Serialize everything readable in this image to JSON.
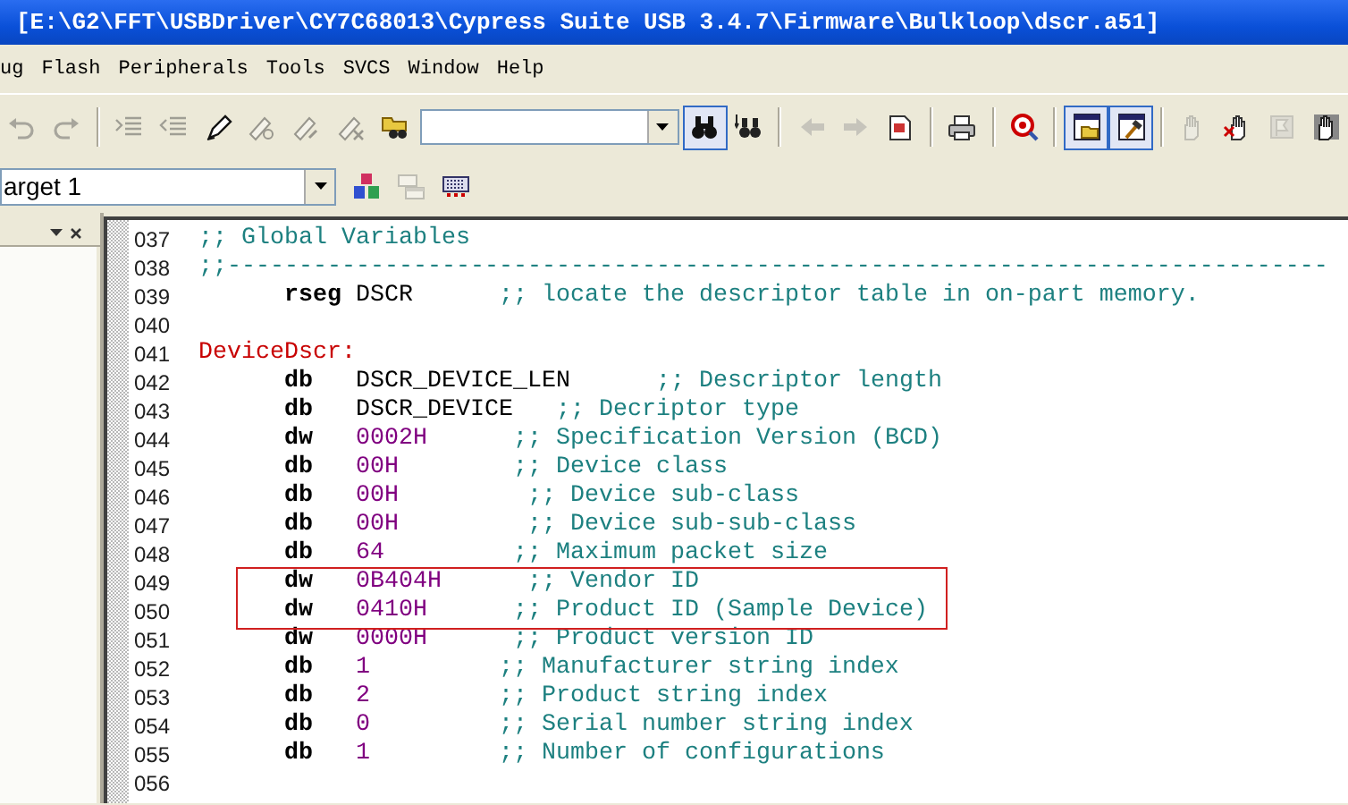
{
  "window": {
    "title": "[E:\\G2\\FFT\\USBDriver\\CY7C68013\\Cypress Suite USB 3.4.7\\Firmware\\Bulkloop\\dscr.a51]"
  },
  "menu_bar": {
    "items": [
      "ug",
      "Flash",
      "Peripherals",
      "Tools",
      "SVCS",
      "Window",
      "Help"
    ]
  },
  "toolbar": {
    "groups": [
      [
        {
          "kind": "undo",
          "disabled": true,
          "pressed": false
        },
        {
          "kind": "redo",
          "disabled": true,
          "pressed": false
        }
      ],
      [
        {
          "kind": "indent",
          "disabled": true,
          "pressed": false
        },
        {
          "kind": "outdent",
          "disabled": true,
          "pressed": false
        },
        {
          "kind": "pen",
          "disabled": false,
          "pressed": false
        },
        {
          "kind": "pen-next",
          "disabled": true,
          "pressed": false
        },
        {
          "kind": "pen-prev",
          "disabled": true,
          "pressed": false
        },
        {
          "kind": "pen-clear",
          "disabled": true,
          "pressed": false
        },
        {
          "kind": "folder-search",
          "disabled": false,
          "pressed": false
        },
        {
          "kind": "combo",
          "disabled": false,
          "pressed": false
        },
        {
          "kind": "find",
          "disabled": false,
          "pressed": true
        },
        {
          "kind": "find-files",
          "disabled": false,
          "pressed": false
        }
      ],
      [
        {
          "kind": "back",
          "disabled": true,
          "pressed": false
        },
        {
          "kind": "forward",
          "disabled": true,
          "pressed": false
        },
        {
          "kind": "page-jump",
          "disabled": false,
          "pressed": false
        }
      ],
      [
        {
          "kind": "print",
          "disabled": false,
          "pressed": false
        }
      ],
      [
        {
          "kind": "debug",
          "disabled": false,
          "pressed": false
        }
      ],
      [
        {
          "kind": "pane-window",
          "disabled": false,
          "pressed": true
        },
        {
          "kind": "pane-build",
          "disabled": false,
          "pressed": true
        }
      ],
      [
        {
          "kind": "hand",
          "disabled": true,
          "pressed": false
        },
        {
          "kind": "hand-cross",
          "disabled": false,
          "pressed": false
        },
        {
          "kind": "flag",
          "disabled": true,
          "pressed": false
        },
        {
          "kind": "hand-grid",
          "disabled": false,
          "pressed": false
        }
      ]
    ]
  },
  "build_toolbar": {
    "target": "arget 1",
    "items": [
      {
        "kind": "cubes",
        "disabled": false
      },
      {
        "kind": "windows",
        "disabled": true
      },
      {
        "kind": "keyboard",
        "disabled": false
      }
    ]
  },
  "editor": {
    "lines": [
      {
        "number": "037",
        "boxed": false,
        "segments": [
          {
            "kind": "comment",
            "text": ";; Global Variables"
          }
        ]
      },
      {
        "number": "038",
        "boxed": false,
        "segments": [
          {
            "kind": "comment",
            "text": ";;-----------------------------------------------------------------------------"
          }
        ]
      },
      {
        "number": "039",
        "boxed": false,
        "segments": [
          {
            "kind": "directive",
            "text": "      rseg"
          },
          {
            "kind": "symbol",
            "text": " DSCR"
          },
          {
            "kind": "comment",
            "text": "      ;; locate the descriptor table in on-part memory."
          }
        ]
      },
      {
        "number": "040",
        "boxed": false
      },
      {
        "number": "041",
        "boxed": false,
        "segments": [
          {
            "kind": "label",
            "text": "DeviceDscr:"
          }
        ]
      },
      {
        "number": "042",
        "boxed": false,
        "segments": [
          {
            "kind": "directive",
            "text": "      db"
          },
          {
            "kind": "symbol",
            "text": "   DSCR_DEVICE_LEN"
          },
          {
            "kind": "comment",
            "text": "      ;; Descriptor length"
          }
        ]
      },
      {
        "number": "043",
        "boxed": false,
        "segments": [
          {
            "kind": "directive",
            "text": "      db"
          },
          {
            "kind": "symbol",
            "text": "   DSCR_DEVICE"
          },
          {
            "kind": "comment",
            "text": "   ;; Decriptor type"
          }
        ]
      },
      {
        "number": "044",
        "boxed": false,
        "segments": [
          {
            "kind": "directive",
            "text": "      dw"
          },
          {
            "kind": "number",
            "text": "   0002H"
          },
          {
            "kind": "comment",
            "text": "      ;; Specification Version (BCD)"
          }
        ]
      },
      {
        "number": "045",
        "boxed": false,
        "segments": [
          {
            "kind": "directive",
            "text": "      db"
          },
          {
            "kind": "number",
            "text": "   00H"
          },
          {
            "kind": "comment",
            "text": "        ;; Device class"
          }
        ]
      },
      {
        "number": "046",
        "boxed": false,
        "segments": [
          {
            "kind": "directive",
            "text": "      db"
          },
          {
            "kind": "number",
            "text": "   00H"
          },
          {
            "kind": "comment",
            "text": "         ;; Device sub-class"
          }
        ]
      },
      {
        "number": "047",
        "boxed": false,
        "segments": [
          {
            "kind": "directive",
            "text": "      db"
          },
          {
            "kind": "number",
            "text": "   00H"
          },
          {
            "kind": "comment",
            "text": "         ;; Device sub-sub-class"
          }
        ]
      },
      {
        "number": "048",
        "boxed": false,
        "segments": [
          {
            "kind": "directive",
            "text": "      db"
          },
          {
            "kind": "number",
            "text": "   64"
          },
          {
            "kind": "comment",
            "text": "         ;; Maximum packet size"
          }
        ]
      },
      {
        "number": "049",
        "boxed": true,
        "segments": [
          {
            "kind": "directive",
            "text": "      dw"
          },
          {
            "kind": "number",
            "text": "   0B404H"
          },
          {
            "kind": "comment",
            "text": "      ;; Vendor ID"
          }
        ]
      },
      {
        "number": "050",
        "boxed": true,
        "segments": [
          {
            "kind": "directive",
            "text": "      dw"
          },
          {
            "kind": "number",
            "text": "   0410H"
          },
          {
            "kind": "comment",
            "text": "      ;; Product ID (Sample Device)"
          }
        ]
      },
      {
        "number": "051",
        "boxed": false,
        "segments": [
          {
            "kind": "directive",
            "text": "      dw"
          },
          {
            "kind": "number",
            "text": "   0000H"
          },
          {
            "kind": "comment",
            "text": "      ;; Product version ID"
          }
        ]
      },
      {
        "number": "052",
        "boxed": false,
        "segments": [
          {
            "kind": "directive",
            "text": "      db"
          },
          {
            "kind": "number",
            "text": "   1"
          },
          {
            "kind": "comment",
            "text": "         ;; Manufacturer string index"
          }
        ]
      },
      {
        "number": "053",
        "boxed": false,
        "segments": [
          {
            "kind": "directive",
            "text": "      db"
          },
          {
            "kind": "number",
            "text": "   2"
          },
          {
            "kind": "comment",
            "text": "         ;; Product string index"
          }
        ]
      },
      {
        "number": "054",
        "boxed": false,
        "segments": [
          {
            "kind": "directive",
            "text": "      db"
          },
          {
            "kind": "number",
            "text": "   0"
          },
          {
            "kind": "comment",
            "text": "         ;; Serial number string index"
          }
        ]
      },
      {
        "number": "055",
        "boxed": false,
        "segments": [
          {
            "kind": "directive",
            "text": "      db"
          },
          {
            "kind": "number",
            "text": "   1"
          },
          {
            "kind": "comment",
            "text": "         ;; Number of configurations"
          }
        ]
      },
      {
        "number": "056",
        "boxed": false
      }
    ]
  }
}
